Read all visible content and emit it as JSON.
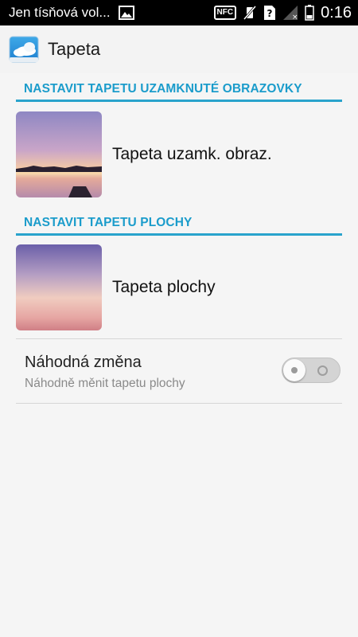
{
  "status_bar": {
    "carrier": "Jen tísňová vol...",
    "time": "0:16",
    "icons": [
      "image-icon",
      "nfc-icon",
      "vibrate-off-icon",
      "sim-unknown-icon",
      "signal-icon",
      "battery-icon"
    ],
    "nfc_label": "NFC"
  },
  "app_bar": {
    "title": "Tapeta",
    "icon": "wallpaper-app-icon"
  },
  "sections": [
    {
      "header": "NASTAVIT TAPETU UZAMKNUTÉ OBRAZOVKY",
      "item_label": "Tapeta uzamk. obraz."
    },
    {
      "header": "NASTAVIT TAPETU PLOCHY",
      "item_label": "Tapeta plochy"
    }
  ],
  "random_change": {
    "title": "Náhodná změna",
    "subtitle": "Náhodně měnit tapetu plochy",
    "enabled": false
  },
  "colors": {
    "accent": "#1b9ccb",
    "divider": "#29a3cc"
  }
}
